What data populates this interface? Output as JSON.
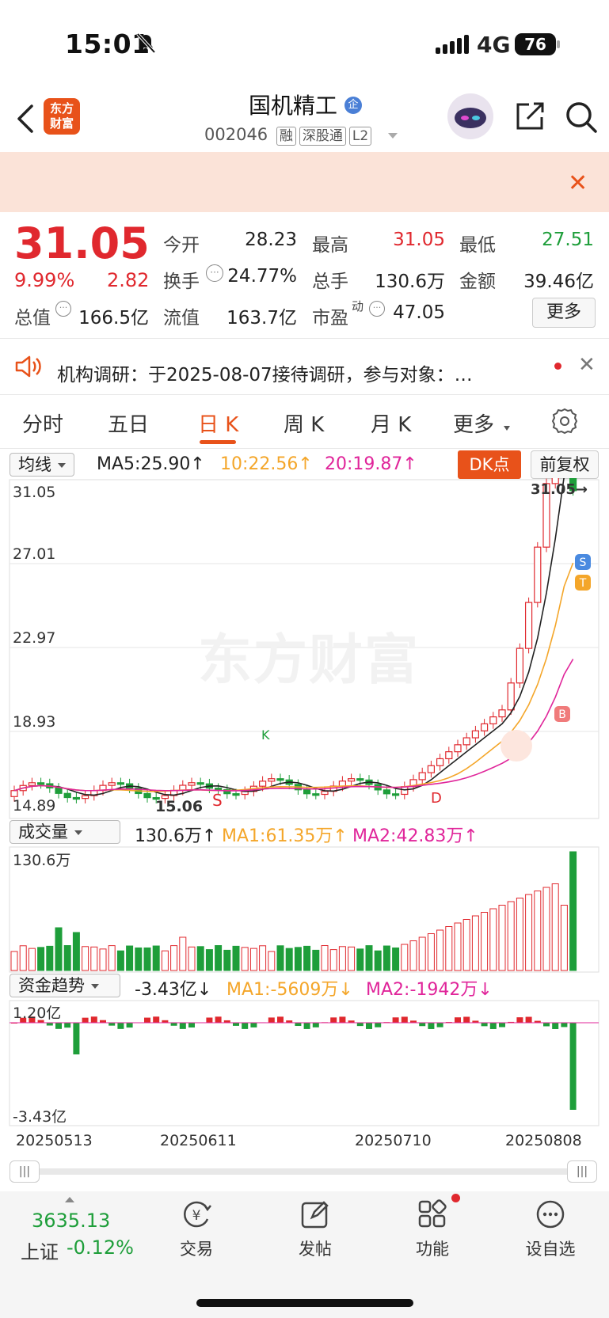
{
  "status_bar": {
    "time": "15:01",
    "network": "4G",
    "battery": "76"
  },
  "header": {
    "back_icon": "chevron-left-icon",
    "logo_line1": "东方",
    "logo_line2": "财富",
    "title": "国机精工",
    "title_badge": "企",
    "code": "002046",
    "tags": [
      "融",
      "深股通",
      "L2"
    ]
  },
  "quote": {
    "price": "31.05",
    "change_pct": "9.99%",
    "change": "2.82",
    "labels": {
      "open": "今开",
      "high": "最高",
      "low": "最低",
      "turnover": "换手",
      "volume": "总手",
      "amount": "金额",
      "mktcap": "总值",
      "float_cap": "流值",
      "pe": "市盈"
    },
    "open": "28.23",
    "high": "31.05",
    "low": "27.51",
    "turnover": "24.77%",
    "volume": "130.6万",
    "amount": "39.46亿",
    "mktcap": "166.5亿",
    "float_cap": "163.7亿",
    "pe_sup": "动",
    "pe": "47.05",
    "more": "更多"
  },
  "notice": {
    "text": "机构调研：于2025-08-07接待调研，参与对象：…"
  },
  "tabs": {
    "items": [
      "分时",
      "五日",
      "日 K",
      "周 K",
      "月 K",
      "更多"
    ],
    "active": "日 K"
  },
  "kline": {
    "indicator": "均线",
    "ma5": "MA5:25.90↑",
    "ma10": "10:22.56↑",
    "ma20": "20:19.87↑",
    "dk_button": "DK点",
    "adjust_button": "前复权",
    "y_ticks": [
      "31.05",
      "27.01",
      "22.97",
      "18.93",
      "14.89"
    ],
    "high_label": "31.05→",
    "low_label": "15.06",
    "watermark": "东方财富",
    "signal_markers": [
      "B",
      "S",
      "K",
      "D"
    ]
  },
  "volume": {
    "indicator": "成交量",
    "value": "130.6万↑",
    "ma1": "MA1:61.35万↑",
    "ma2": "MA2:42.83万↑",
    "max_label": "130.6万"
  },
  "fund": {
    "indicator": "资金趋势",
    "value": "-3.43亿↓",
    "ma1": "MA1:-5609万↓",
    "ma2": "MA2:-1942万↓",
    "max_label": "1.20亿",
    "min_label": "-3.43亿"
  },
  "dates": [
    "20250513",
    "20250611",
    "20250710",
    "20250808"
  ],
  "bottom_bar": {
    "index_value": "3635.13",
    "index_name": "上证",
    "index_change": "-0.12%",
    "items": [
      {
        "label": "交易",
        "icon": "yen-exchange-icon"
      },
      {
        "label": "发帖",
        "icon": "edit-post-icon"
      },
      {
        "label": "功能",
        "icon": "grid-apps-icon"
      },
      {
        "label": "设自选",
        "icon": "more-circle-icon"
      }
    ]
  },
  "colors": {
    "up": "#e0282e",
    "down": "#1e9e3a",
    "accent": "#e8521a",
    "ma5": "#222222",
    "ma10": "#f4a62a",
    "ma20": "#e0259a"
  }
}
